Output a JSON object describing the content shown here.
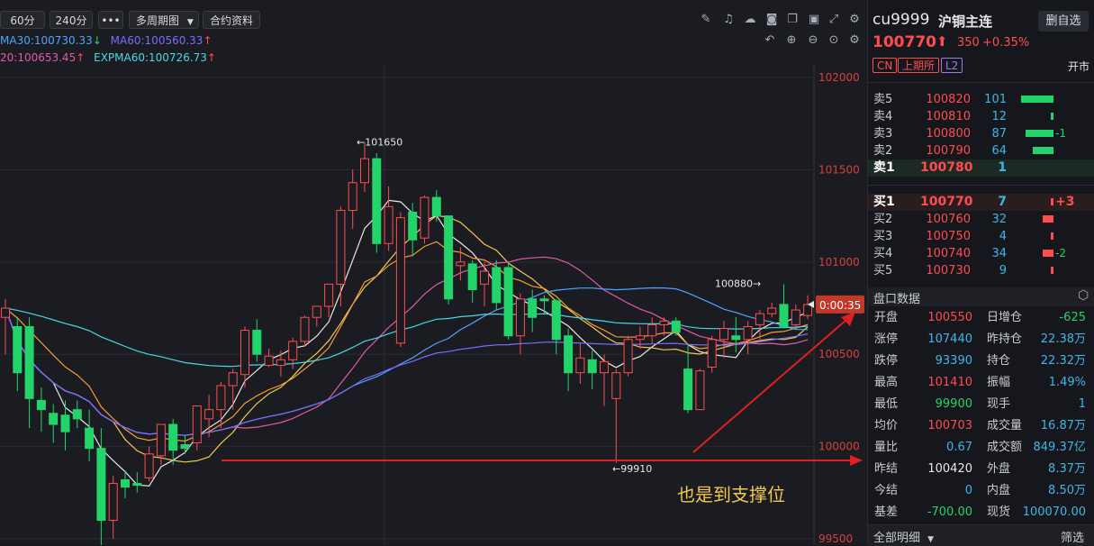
{
  "toolbar": {
    "periods": [
      "60分",
      "240分"
    ],
    "more_label": "•••",
    "multi_period_label": "多周期图",
    "contract_info_label": "合约资料"
  },
  "legend": {
    "row1": [
      {
        "text": "MA30:100730.33",
        "arrow": "↓",
        "color": "#4ea3ff",
        "arrow_color": "#22d46a"
      },
      {
        "text": "MA60:100560.33",
        "arrow": "↑",
        "color": "#7b6cff",
        "arrow_color": "#ff4d4f"
      }
    ],
    "row2": [
      {
        "text": "20:100653.45",
        "arrow": "↑",
        "color": "#e05aa8",
        "arrow_color": "#ff4d4f"
      },
      {
        "text": "EXPMA60:100726.73",
        "arrow": "↑",
        "color": "#49d6e8",
        "arrow_color": "#ff4d4f"
      }
    ]
  },
  "chart_data": {
    "type": "candlestick",
    "y_ticks": [
      "102000",
      "101500",
      "101000",
      "100500",
      "100000",
      "99500"
    ],
    "ylim": [
      99500,
      102000
    ],
    "annotations": {
      "high_label": "←101650",
      "low_label": "←99910",
      "recent_high_label": "100880→",
      "countdown": "0:00:35",
      "support_text": "也是到支撑位"
    },
    "candles": [
      {
        "o": 100700,
        "h": 100800,
        "l": 100500,
        "c": 100750
      },
      {
        "o": 100650,
        "h": 100700,
        "l": 100300,
        "c": 100400
      },
      {
        "o": 100650,
        "h": 100700,
        "l": 100100,
        "c": 100260
      },
      {
        "o": 100250,
        "h": 100320,
        "l": 100080,
        "c": 100200
      },
      {
        "o": 100180,
        "h": 100230,
        "l": 100020,
        "c": 100120
      },
      {
        "o": 100170,
        "h": 100250,
        "l": 99980,
        "c": 100080
      },
      {
        "o": 100200,
        "h": 100250,
        "l": 100100,
        "c": 100150
      },
      {
        "o": 100100,
        "h": 100200,
        "l": 99920,
        "c": 99990
      },
      {
        "o": 99990,
        "h": 100100,
        "l": 99420,
        "c": 99600
      },
      {
        "o": 99600,
        "h": 99840,
        "l": 99500,
        "c": 99800
      },
      {
        "o": 99820,
        "h": 99870,
        "l": 99720,
        "c": 99780
      },
      {
        "o": 99800,
        "h": 99860,
        "l": 99750,
        "c": 99790
      },
      {
        "o": 99830,
        "h": 100000,
        "l": 99810,
        "c": 99960
      },
      {
        "o": 99950,
        "h": 100100,
        "l": 99900,
        "c": 100120
      },
      {
        "o": 100120,
        "h": 100150,
        "l": 99900,
        "c": 99980
      },
      {
        "o": 100010,
        "h": 100060,
        "l": 99960,
        "c": 99990
      },
      {
        "o": 100020,
        "h": 100220,
        "l": 99980,
        "c": 100220
      },
      {
        "o": 100150,
        "h": 100280,
        "l": 100050,
        "c": 100200
      },
      {
        "o": 100200,
        "h": 100350,
        "l": 100100,
        "c": 100330
      },
      {
        "o": 100330,
        "h": 100420,
        "l": 100200,
        "c": 100400
      },
      {
        "o": 100390,
        "h": 100650,
        "l": 100320,
        "c": 100630
      },
      {
        "o": 100630,
        "h": 100690,
        "l": 100460,
        "c": 100500
      },
      {
        "o": 100440,
        "h": 100530,
        "l": 100430,
        "c": 100490
      },
      {
        "o": 100440,
        "h": 100520,
        "l": 100380,
        "c": 100470
      },
      {
        "o": 100470,
        "h": 100590,
        "l": 100420,
        "c": 100570
      },
      {
        "o": 100570,
        "h": 100710,
        "l": 100540,
        "c": 100700
      },
      {
        "o": 100700,
        "h": 100760,
        "l": 100650,
        "c": 100760
      },
      {
        "o": 100760,
        "h": 100880,
        "l": 100700,
        "c": 100880
      },
      {
        "o": 100880,
        "h": 101300,
        "l": 100760,
        "c": 101280
      },
      {
        "o": 101280,
        "h": 101500,
        "l": 101180,
        "c": 101430
      },
      {
        "o": 101430,
        "h": 101650,
        "l": 101380,
        "c": 101560
      },
      {
        "o": 101560,
        "h": 101590,
        "l": 101050,
        "c": 101100
      },
      {
        "o": 101100,
        "h": 101410,
        "l": 101060,
        "c": 101300
      },
      {
        "o": 100560,
        "h": 101270,
        "l": 100540,
        "c": 101240
      },
      {
        "o": 101270,
        "h": 101320,
        "l": 101030,
        "c": 101120
      },
      {
        "o": 101130,
        "h": 101360,
        "l": 101100,
        "c": 101350
      },
      {
        "o": 101350,
        "h": 101390,
        "l": 101220,
        "c": 101250
      },
      {
        "o": 101250,
        "h": 101240,
        "l": 100770,
        "c": 100800
      },
      {
        "o": 100980,
        "h": 101080,
        "l": 100900,
        "c": 101000
      },
      {
        "o": 100990,
        "h": 101010,
        "l": 100780,
        "c": 100850
      },
      {
        "o": 100880,
        "h": 101000,
        "l": 100760,
        "c": 100950
      },
      {
        "o": 100970,
        "h": 101010,
        "l": 100740,
        "c": 100780
      },
      {
        "o": 100970,
        "h": 101000,
        "l": 100580,
        "c": 100600
      },
      {
        "o": 100600,
        "h": 100830,
        "l": 100500,
        "c": 100800
      },
      {
        "o": 100800,
        "h": 100850,
        "l": 100620,
        "c": 100700
      },
      {
        "o": 100800,
        "h": 100820,
        "l": 100720,
        "c": 100790
      },
      {
        "o": 100790,
        "h": 100800,
        "l": 100500,
        "c": 100580
      },
      {
        "o": 100600,
        "h": 100640,
        "l": 100300,
        "c": 100400
      },
      {
        "o": 100400,
        "h": 100560,
        "l": 100340,
        "c": 100480
      },
      {
        "o": 100470,
        "h": 100520,
        "l": 100310,
        "c": 100400
      },
      {
        "o": 100400,
        "h": 100500,
        "l": 100220,
        "c": 100460
      },
      {
        "o": 100260,
        "h": 100420,
        "l": 99910,
        "c": 100400
      },
      {
        "o": 100400,
        "h": 100600,
        "l": 100380,
        "c": 100580
      },
      {
        "o": 100580,
        "h": 100650,
        "l": 100530,
        "c": 100600
      },
      {
        "o": 100600,
        "h": 100700,
        "l": 100560,
        "c": 100660
      },
      {
        "o": 100660,
        "h": 100700,
        "l": 100600,
        "c": 100680
      },
      {
        "o": 100680,
        "h": 100700,
        "l": 100600,
        "c": 100620
      },
      {
        "o": 100420,
        "h": 100560,
        "l": 100180,
        "c": 100200
      },
      {
        "o": 100200,
        "h": 100420,
        "l": 100200,
        "c": 100410
      },
      {
        "o": 100430,
        "h": 100600,
        "l": 100400,
        "c": 100580
      },
      {
        "o": 100580,
        "h": 100680,
        "l": 100480,
        "c": 100640
      },
      {
        "o": 100600,
        "h": 100700,
        "l": 100510,
        "c": 100580
      },
      {
        "o": 100580,
        "h": 100680,
        "l": 100500,
        "c": 100650
      },
      {
        "o": 100660,
        "h": 100740,
        "l": 100580,
        "c": 100720
      },
      {
        "o": 100720,
        "h": 100780,
        "l": 100700,
        "c": 100750
      },
      {
        "o": 100770,
        "h": 100880,
        "l": 100700,
        "c": 100650
      },
      {
        "o": 100660,
        "h": 100770,
        "l": 100640,
        "c": 100740
      },
      {
        "o": 100710,
        "h": 100820,
        "l": 100690,
        "c": 100770
      }
    ]
  },
  "header": {
    "code": "cu9999",
    "name": "沪铜主连",
    "remove_label": "删自选",
    "price": "100770",
    "change": "350",
    "change_pct": "+0.35%",
    "tag_cn": "CN",
    "tag_exchange": "上期所",
    "tag_level": "L2",
    "status": "开市"
  },
  "asks": [
    {
      "label": "卖5",
      "price": "100820",
      "vol": "101",
      "bar": 1.0,
      "chg": ""
    },
    {
      "label": "卖4",
      "price": "100810",
      "vol": "12",
      "bar": 0.08,
      "chg": ""
    },
    {
      "label": "卖3",
      "price": "100800",
      "vol": "87",
      "bar": 0.86,
      "chg": "-1"
    },
    {
      "label": "卖2",
      "price": "100790",
      "vol": "64",
      "bar": 0.63,
      "chg": ""
    },
    {
      "label": "卖1",
      "price": "100780",
      "vol": "1",
      "bar": 0.0,
      "chg": ""
    }
  ],
  "bids": [
    {
      "label": "买1",
      "price": "100770",
      "vol": "7",
      "bar": 0.05,
      "chg": "+3"
    },
    {
      "label": "买2",
      "price": "100760",
      "vol": "32",
      "bar": 0.32,
      "chg": ""
    },
    {
      "label": "买3",
      "price": "100750",
      "vol": "4",
      "bar": 0.04,
      "chg": ""
    },
    {
      "label": "买4",
      "price": "100740",
      "vol": "34",
      "bar": 0.34,
      "chg": "-2"
    },
    {
      "label": "买5",
      "price": "100730",
      "vol": "9",
      "bar": 0.08,
      "chg": ""
    }
  ],
  "panel": {
    "title": "盘口数据",
    "rows": [
      {
        "l1": "开盘",
        "v1": "100550",
        "c1": "red",
        "l2": "日增仓",
        "v2": "-625",
        "c2": "green"
      },
      {
        "l1": "涨停",
        "v1": "107440",
        "c1": "blue",
        "l2": "昨持仓",
        "v2": "22.38万",
        "c2": "blue"
      },
      {
        "l1": "跌停",
        "v1": "93390",
        "c1": "blue",
        "l2": "持仓",
        "v2": "22.32万",
        "c2": "blue"
      },
      {
        "l1": "最高",
        "v1": "101410",
        "c1": "red",
        "l2": "振幅",
        "v2": "1.49%",
        "c2": "blue"
      },
      {
        "l1": "最低",
        "v1": "99900",
        "c1": "green",
        "l2": "现手",
        "v2": "1",
        "c2": "blue"
      },
      {
        "l1": "均价",
        "v1": "100703",
        "c1": "red",
        "l2": "成交量",
        "v2": "16.87万",
        "c2": "blue"
      },
      {
        "l1": "量比",
        "v1": "0.67",
        "c1": "blue",
        "l2": "成交额",
        "v2": "849.37亿",
        "c2": "blue"
      },
      {
        "l1": "昨结",
        "v1": "100420",
        "c1": "white",
        "l2": "外盘",
        "v2": "8.37万",
        "c2": "blue"
      },
      {
        "l1": "今结",
        "v1": "0",
        "c1": "blue",
        "l2": "内盘",
        "v2": "8.50万",
        "c2": "blue"
      },
      {
        "l1": "基差",
        "v1": "-700.00",
        "c1": "green",
        "l2": "现货",
        "v2": "100070.00",
        "c2": "blue"
      }
    ]
  },
  "footer": {
    "detail_label": "全部明细",
    "filter_label": "筛选"
  }
}
